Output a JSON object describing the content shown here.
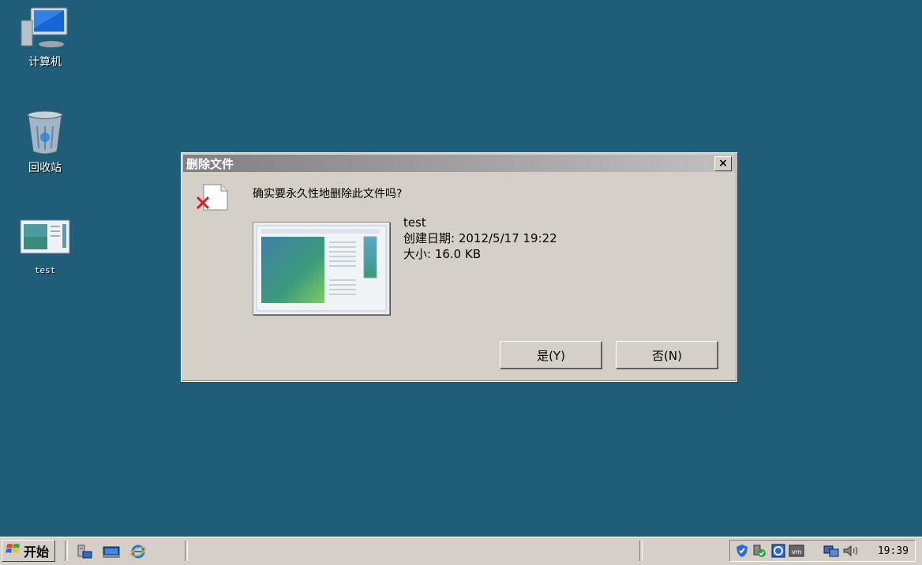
{
  "desktop": {
    "icons": [
      {
        "label": "计算机",
        "icon": "computer-icon"
      },
      {
        "label": "回收站",
        "icon": "recycle-bin-icon"
      },
      {
        "label": "test",
        "icon": "document-thumbnail-icon"
      }
    ]
  },
  "dialog": {
    "title": "删除文件",
    "close_symbol": "×",
    "question": "确实要永久性地删除此文件吗?",
    "file_name": "test",
    "created_line": "创建日期: 2012/5/17 19:22",
    "size_line": "大小: 16.0 KB",
    "yes_label": "是(Y)",
    "no_label": "否(N)"
  },
  "taskbar": {
    "start_label": "开始",
    "clock": "19:39",
    "quick_launch": [
      "server-manager-icon",
      "show-desktop-icon",
      "internet-explorer-icon"
    ],
    "tray_icons": [
      "security-shield-icon",
      "network-check-icon",
      "sync-icon",
      "vmware-icon",
      "network-icon",
      "volume-icon"
    ]
  },
  "colors": {
    "desktop": "#1f5d79",
    "dialog_bg": "#d4d0c8",
    "titlebar_inactive": "#808080"
  }
}
